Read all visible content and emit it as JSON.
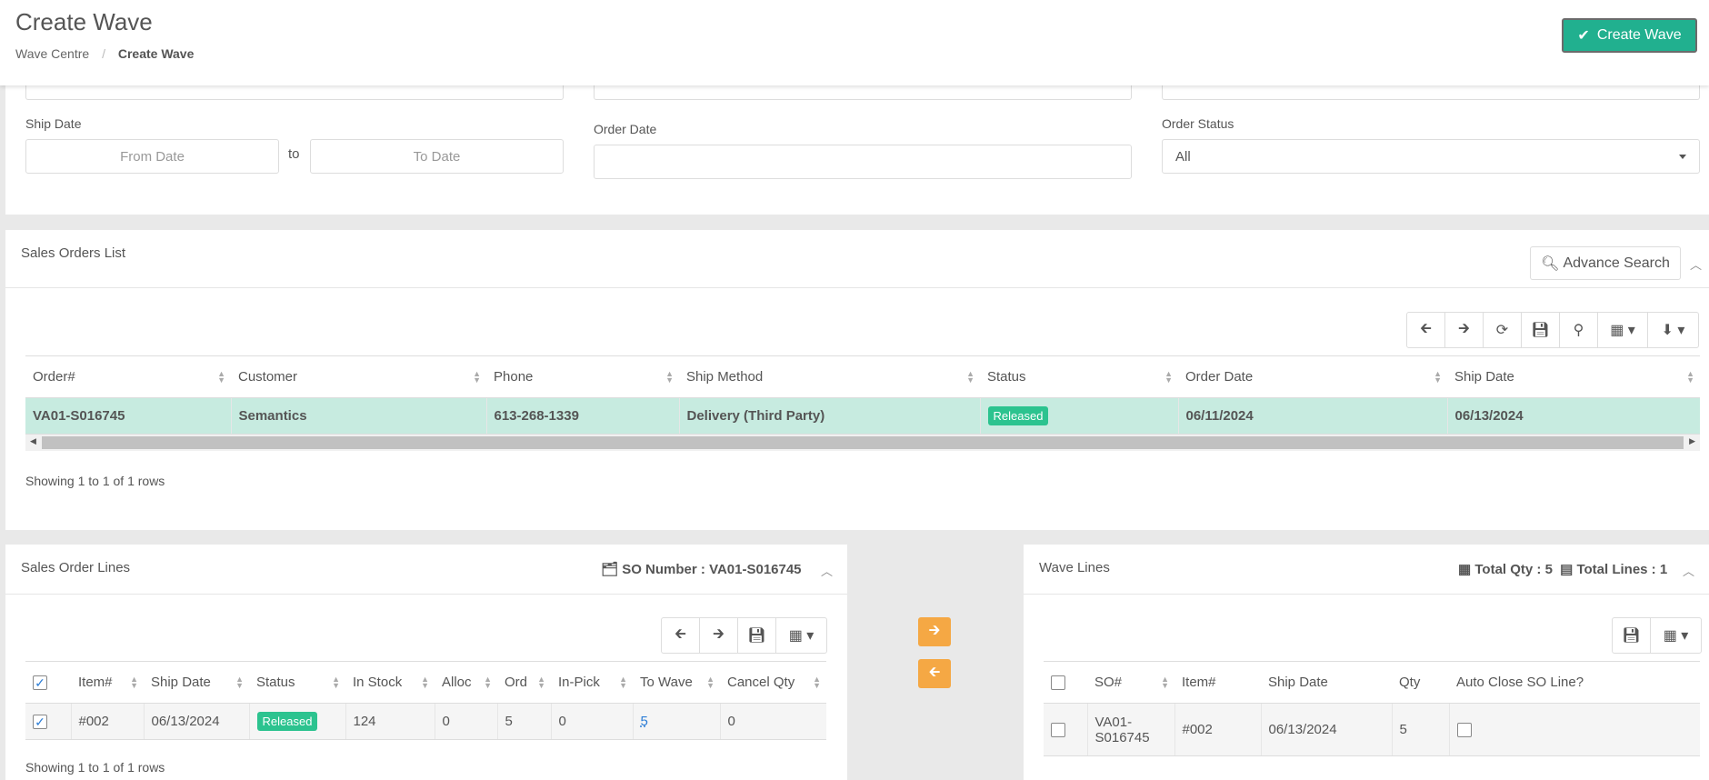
{
  "header": {
    "title": "Create Wave",
    "breadcrumb_parent": "Wave Centre",
    "breadcrumb_current": "Create Wave",
    "create_button": "Create Wave"
  },
  "filters": {
    "ship_date_label": "Ship Date",
    "from_placeholder": "From Date",
    "to_sep": "to",
    "to_placeholder": "To Date",
    "order_date_label": "Order Date",
    "order_status_label": "Order Status",
    "order_status_value": "All"
  },
  "sales_orders": {
    "title": "Sales Orders List",
    "advance_search": "Advance Search",
    "columns": [
      "Order#",
      "Customer",
      "Phone",
      "Ship Method",
      "Status",
      "Order Date",
      "Ship Date"
    ],
    "rows": [
      {
        "order": "VA01-S016745",
        "customer": "Semantics",
        "phone": "613-268-1339",
        "ship_method": "Delivery (Third Party)",
        "status": "Released",
        "order_date": "06/11/2024",
        "ship_date": "06/13/2024"
      }
    ],
    "showing": "Showing 1 to 1 of 1 rows"
  },
  "so_lines": {
    "title": "Sales Order Lines",
    "so_number": "SO Number : VA01-S016745",
    "columns": [
      "Item#",
      "Ship Date",
      "Status",
      "In Stock",
      "Alloc",
      "Ord",
      "In-Pick",
      "To Wave",
      "Cancel Qty"
    ],
    "rows": [
      {
        "item": "#002",
        "ship_date": "06/13/2024",
        "status": "Released",
        "in_stock": "124",
        "alloc": "0",
        "ord": "5",
        "in_pick": "0",
        "to_wave": "5",
        "cancel_qty": "0"
      }
    ],
    "showing": "Showing 1 to 1 of 1 rows"
  },
  "wave_lines": {
    "title": "Wave Lines",
    "total_qty": "Total Qty : 5",
    "total_lines": "Total Lines : 1",
    "columns": [
      "SO#",
      "Item#",
      "Ship Date",
      "Qty",
      "Auto Close SO Line?"
    ],
    "rows": [
      {
        "so_line1": "VA01-",
        "so_line2": "S016745",
        "item": "#002",
        "ship_date": "06/13/2024",
        "qty": "5"
      }
    ]
  },
  "colors": {
    "accent": "#21b08f",
    "badge": "#2cc38f",
    "selected_row": "#c7ebe0",
    "move_button": "#f5a844"
  }
}
